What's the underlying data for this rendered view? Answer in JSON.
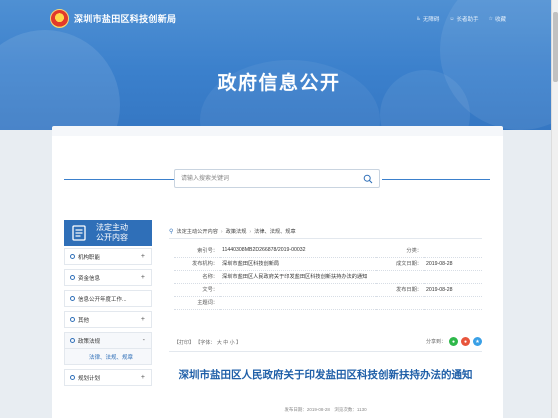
{
  "header": {
    "site_name": "深圳市盐田区科技创新局",
    "links": [
      {
        "icon": "accessibility-icon",
        "label": "无障碍"
      },
      {
        "icon": "elder-helper-icon",
        "label": "长者助手"
      },
      {
        "icon": "star-icon",
        "label": "收藏"
      }
    ],
    "banner_title": "政府信息公开"
  },
  "search": {
    "placeholder": "请输入搜索关键词"
  },
  "sidebar": {
    "title_line1": "法定主动",
    "title_line2": "公开内容",
    "items": [
      {
        "label": "机构职能",
        "toggle": "+"
      },
      {
        "label": "资金信息",
        "toggle": "+"
      },
      {
        "label": "信息公开年度工作...",
        "toggle": ""
      },
      {
        "label": "其他",
        "toggle": "+"
      },
      {
        "label": "政策法规",
        "toggle": "-"
      },
      {
        "label": "规划计划",
        "toggle": "+"
      }
    ],
    "sub_item": "法律、法规、规章"
  },
  "breadcrumb": [
    "法定主动公开内容",
    "政策法规",
    "法律、法规、规章"
  ],
  "meta": {
    "index_label": "索引号：",
    "index_value": "11440308MB2D266878/2019-00032",
    "category_label": "分类：",
    "category_value": "",
    "publisher_label": "发布机构：",
    "publisher_value": "深圳市盐田区科技创新局",
    "created_label": "成文日期：",
    "created_value": "2019-08-28",
    "name_label": "名称：",
    "name_value": "深圳市盐田区人民政府关于印发盐田区科技创新扶持办法的通知",
    "docno_label": "文号：",
    "docno_value": "",
    "pubdate_label": "发布日期：",
    "pubdate_value": "2019-08-28",
    "subject_label": "主题词：",
    "subject_value": ""
  },
  "tools": {
    "print": "【打印】",
    "font_label": "【字体：",
    "font_large": "大",
    "font_medium": "中",
    "font_small": "小",
    "font_end": "】",
    "share_label": "分享到："
  },
  "article": {
    "title": "深圳市盐田区人民政府关于印发盐田区科技创新扶持办法的通知",
    "footer": "发布日期：2019-08-28　浏览次数：1130"
  },
  "colors": {
    "primary": "#2f6fb8",
    "banner": "#3b80cc",
    "title": "#1f5fa8"
  }
}
